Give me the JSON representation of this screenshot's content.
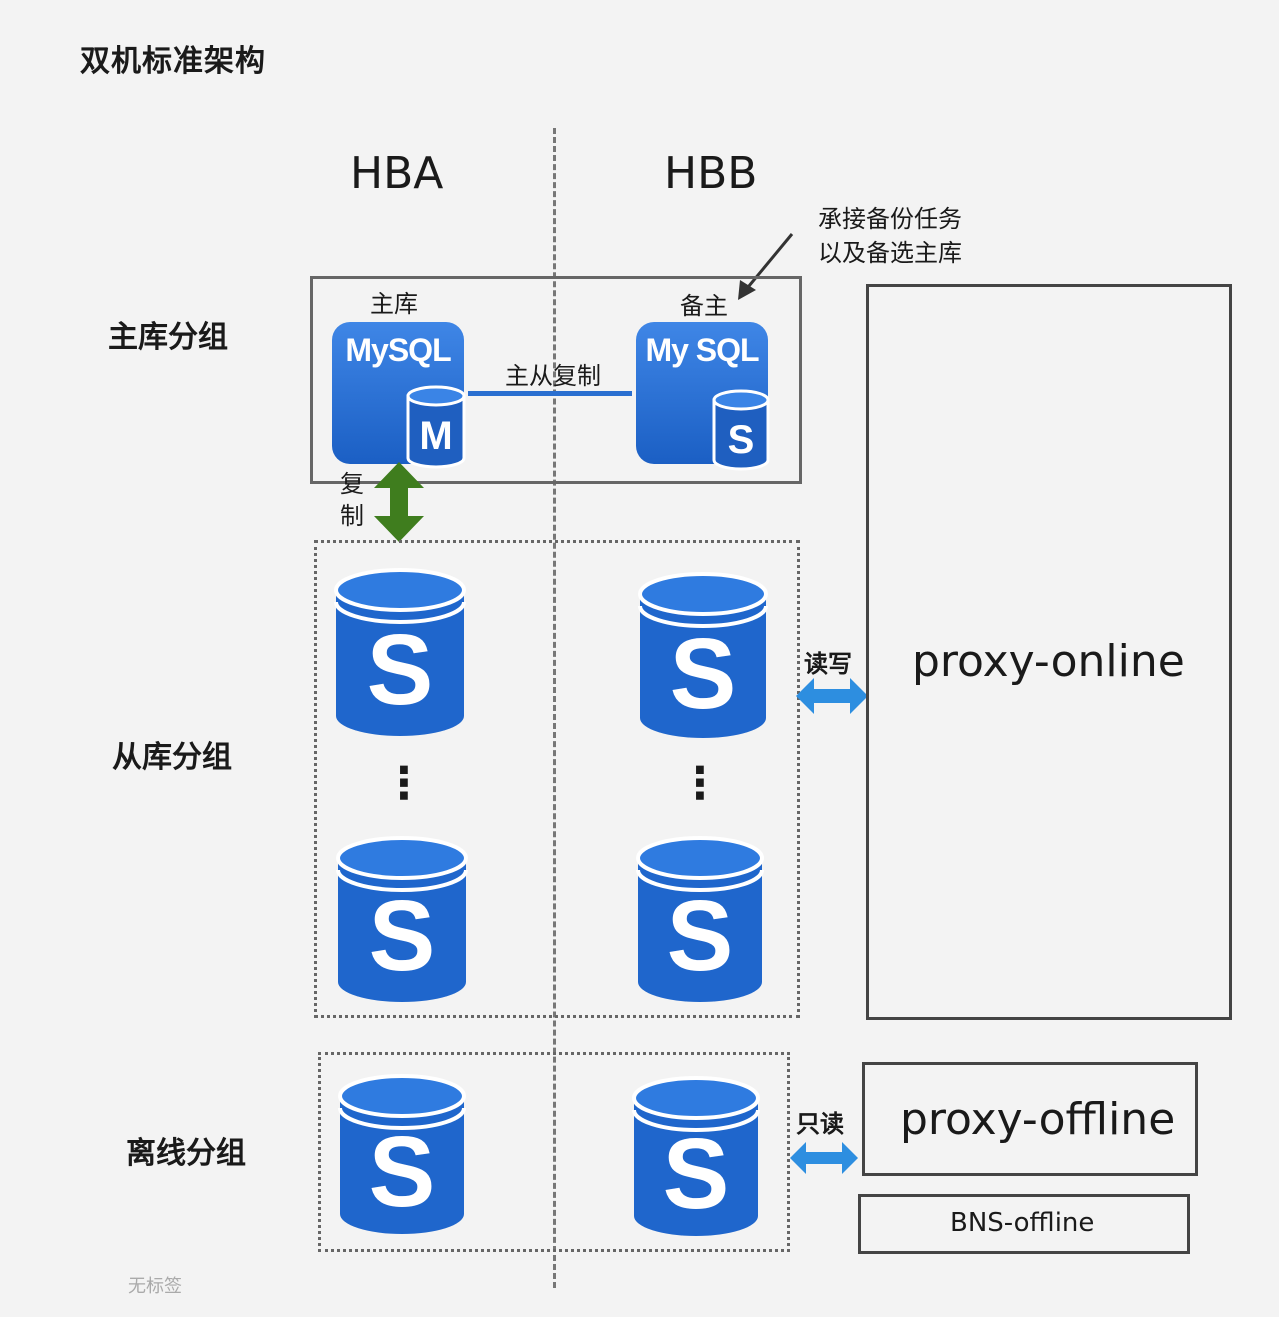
{
  "title": "双机标准架构",
  "columns": {
    "a": "HBA",
    "b": "HBB"
  },
  "groups": {
    "master": "主库分组",
    "slave": "从库分组",
    "offline": "离线分组"
  },
  "master_group": {
    "primary_label": "主库",
    "standby_label": "备主",
    "primary_brand": "MySQL",
    "standby_brand": "My SQL",
    "primary_badge": "M",
    "standby_badge": "S",
    "replication_label": "主从复制",
    "annotation_line1": "承接备份任务",
    "annotation_line2": "以及备选主库"
  },
  "copy_arrow": {
    "char1": "复",
    "char2": "制"
  },
  "slave_glyph": "S",
  "ellipsis": "⋮",
  "proxies": {
    "online": "proxy-online",
    "offline": "proxy-offline",
    "bns": "BNS-offline",
    "rw_label": "读写",
    "ro_label": "只读"
  },
  "watermark": "无标签",
  "colors": {
    "db_blue": "#1f66cc",
    "db_top": "#2f7be0",
    "arrow_green": "#3f7d1e",
    "arrow_blue": "#2d8ee0"
  }
}
